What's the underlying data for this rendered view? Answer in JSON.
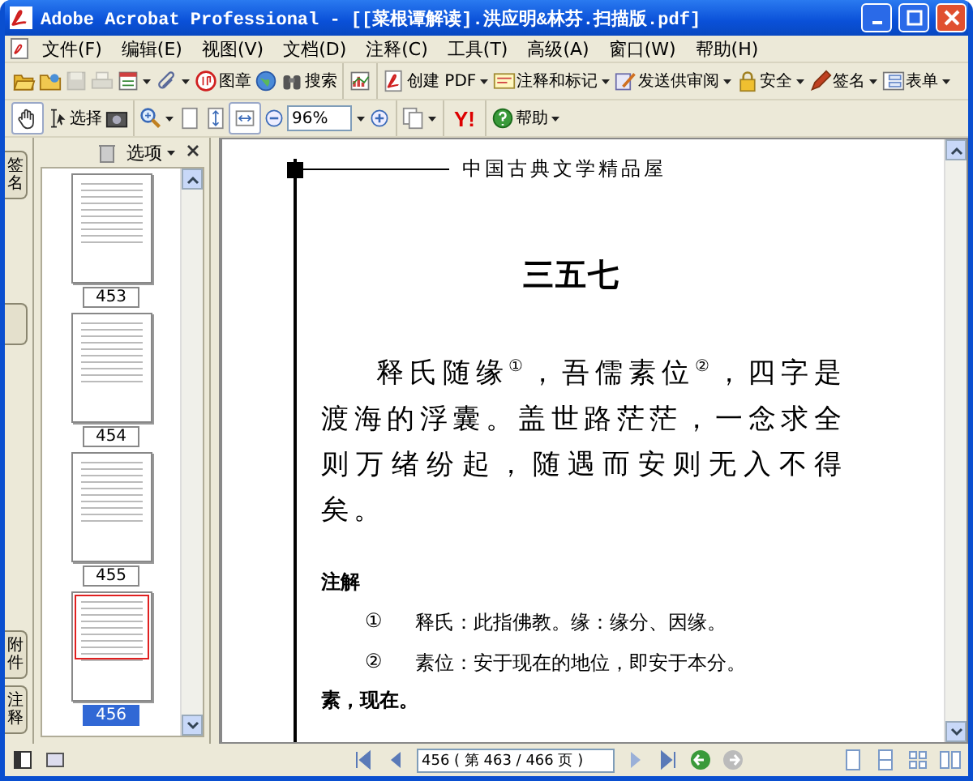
{
  "window": {
    "title": "Adobe Acrobat Professional - [[菜根谭解读].洪应明&林芬.扫描版.pdf]"
  },
  "menu": [
    "文件(F)",
    "编辑(E)",
    "视图(V)",
    "文档(D)",
    "注释(C)",
    "工具(T)",
    "高级(A)",
    "窗口(W)",
    "帮助(H)"
  ],
  "toolbar_1": [
    [
      {
        "disabled": false,
        "dropdown": false
      },
      {
        "disabled": false,
        "dropdown": false
      },
      {
        "disabled": true,
        "dropdown": false
      },
      {
        "disabled": true,
        "dropdown": false
      },
      {
        "disabled": false,
        "dropdown": true
      },
      {
        "disabled": false,
        "dropdown": true
      },
      {
        "label": "图章",
        "disabled": false,
        "dropdown": false
      },
      {
        "disabled": false,
        "dropdown": false
      },
      {
        "label": "搜索",
        "disabled": false,
        "dropdown": false
      }
    ],
    [
      {
        "disabled": false,
        "dropdown": false
      }
    ],
    [
      {
        "label": "创建 PDF",
        "disabled": false,
        "dropdown": true
      },
      {
        "label": "注释和标记",
        "disabled": false,
        "dropdown": true
      },
      {
        "label": "发送供审阅",
        "disabled": false,
        "dropdown": true
      },
      {
        "label": "安全",
        "disabled": false,
        "dropdown": true
      },
      {
        "label": "签名",
        "disabled": false,
        "dropdown": true
      },
      {
        "label": "表单",
        "disabled": false,
        "dropdown": true
      }
    ]
  ],
  "toolbar_2": [
    [
      {
        "kind": "button",
        "selected": true,
        "dropdown": false
      },
      {
        "kind": "button",
        "label": "选择",
        "selected": false,
        "dropdown": false
      },
      {
        "kind": "button",
        "selected": false,
        "dropdown": false
      }
    ],
    [
      {
        "kind": "button",
        "selected": false,
        "dropdown": true
      },
      {
        "kind": "button",
        "selected": false,
        "dropdown": false
      },
      {
        "kind": "button",
        "selected": false,
        "dropdown": false
      },
      {
        "kind": "button",
        "selected": true,
        "dropdown": false
      },
      {
        "kind": "button",
        "selected": false,
        "dropdown": false
      },
      {
        "kind": "zoom_field",
        "value": "96%"
      },
      {
        "kind": "button",
        "selected": false,
        "dropdown": false
      }
    ],
    [
      {
        "kind": "button",
        "selected": false,
        "dropdown": true
      }
    ],
    [
      {
        "kind": "logo",
        "label": "Y!"
      }
    ],
    [
      {
        "kind": "button",
        "label": "帮助",
        "selected": false,
        "dropdown": true
      }
    ]
  ],
  "side_tabs": [
    {
      "kind": "text",
      "label": "签名"
    },
    {
      "kind": "blank"
    },
    {
      "kind": "text",
      "label": "附件"
    },
    {
      "kind": "text",
      "label": "注释"
    }
  ],
  "nav_pane": {
    "options": "选项",
    "thumbnails": [
      {
        "page": "453",
        "selected": false
      },
      {
        "page": "454",
        "selected": false
      },
      {
        "page": "455",
        "selected": false
      },
      {
        "page": "456",
        "selected": true
      }
    ]
  },
  "document": {
    "running_head": "中国古典文学精品屋",
    "heading": "三五七",
    "paragraph": "释氏随缘$^{①}$，吾儒素位$^{②}$，四字是渡海的浮囊。盖世路茫茫，一念求全则万绪纷起，随遇而安则无入不得矣。",
    "notes_heading": "注解",
    "notes": [
      {
        "mark": "①",
        "text": "释氏：此指佛教。缘：缘分、因缘。"
      },
      {
        "mark": "②",
        "text": "素位：安于现在的地位，即安于本分。"
      }
    ],
    "continuation": "素，现在。"
  },
  "status_bar": {
    "page_field": "456 ( 第 463 / 466 页 )"
  }
}
